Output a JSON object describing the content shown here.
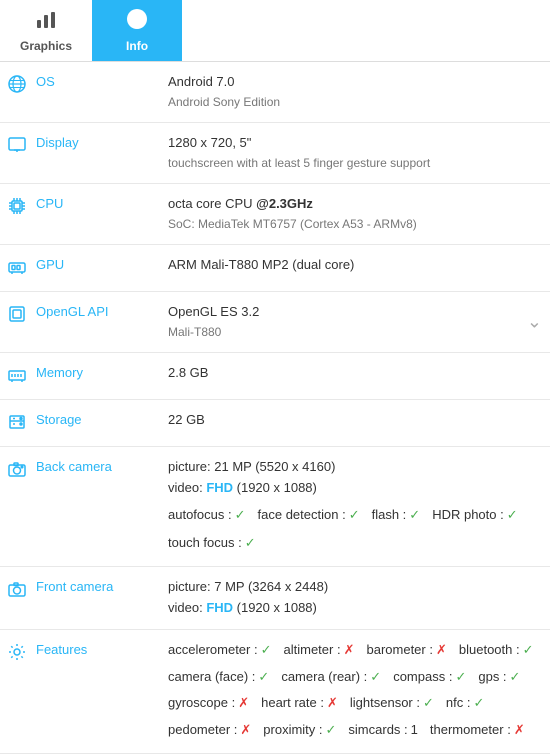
{
  "tabs": [
    {
      "id": "graphics",
      "label": "Graphics",
      "icon": "📊",
      "active": false
    },
    {
      "id": "info",
      "label": "Info",
      "icon": "ℹ",
      "active": true
    }
  ],
  "rows": [
    {
      "id": "os",
      "icon": "🌐",
      "label": "OS",
      "value_main": "Android 7.0",
      "value_sub": "Android Sony Edition"
    },
    {
      "id": "display",
      "icon": "📱",
      "label": "Display",
      "value_main": "1280 x 720, 5\"",
      "value_sub": "touchscreen with at least 5 finger gesture support"
    },
    {
      "id": "cpu",
      "icon": "⚙",
      "label": "CPU",
      "value_main": "octa core CPU @2.3GHz",
      "value_sub": "SoC: MediaTek MT6757 (Cortex A53 - ARMv8)"
    },
    {
      "id": "gpu",
      "icon": "🎮",
      "label": "GPU",
      "value_main": "ARM Mali-T880 MP2 (dual core)",
      "value_sub": ""
    },
    {
      "id": "opengl",
      "icon": "🖼",
      "label": "OpenGL API",
      "value_main": "OpenGL ES 3.2",
      "value_sub": "Mali-T880",
      "has_chevron": true
    },
    {
      "id": "memory",
      "icon": "💾",
      "label": "Memory",
      "value_main": "2.8 GB",
      "value_sub": ""
    },
    {
      "id": "storage",
      "icon": "📦",
      "label": "Storage",
      "value_main": "22 GB",
      "value_sub": ""
    },
    {
      "id": "back_camera",
      "icon": "📷",
      "label": "Back camera",
      "type": "camera_back"
    },
    {
      "id": "front_camera",
      "icon": "📸",
      "label": "Front camera",
      "type": "camera_front"
    },
    {
      "id": "features",
      "icon": "⚙",
      "label": "Features",
      "type": "features"
    }
  ],
  "back_camera": {
    "picture": "picture: 21 MP (5520 x 4160)",
    "video": "video: FHD (1920 x 1088)",
    "autofocus": true,
    "face_detection": true,
    "flash": true,
    "hdr_photo": true,
    "touch_focus": true
  },
  "front_camera": {
    "picture": "picture: 7 MP (3264 x 2448)",
    "video": "video: FHD (1920 x 1088)"
  },
  "features": {
    "items": [
      {
        "name": "accelerometer",
        "ok": true
      },
      {
        "name": "altimeter",
        "ok": false
      },
      {
        "name": "barometer",
        "ok": false
      },
      {
        "name": "bluetooth",
        "ok": true
      },
      {
        "name": "camera (face)",
        "ok": true
      },
      {
        "name": "camera (rear)",
        "ok": true
      },
      {
        "name": "compass",
        "ok": true
      },
      {
        "name": "gps",
        "ok": true
      },
      {
        "name": "gyroscope",
        "ok": false
      },
      {
        "name": "heart rate",
        "ok": false
      },
      {
        "name": "lightsensor",
        "ok": true
      },
      {
        "name": "nfc",
        "ok": true
      },
      {
        "name": "pedometer",
        "ok": false
      },
      {
        "name": "proximity",
        "ok": true
      },
      {
        "name": "simcards",
        "count": "1"
      },
      {
        "name": "thermometer",
        "ok": false
      }
    ]
  }
}
